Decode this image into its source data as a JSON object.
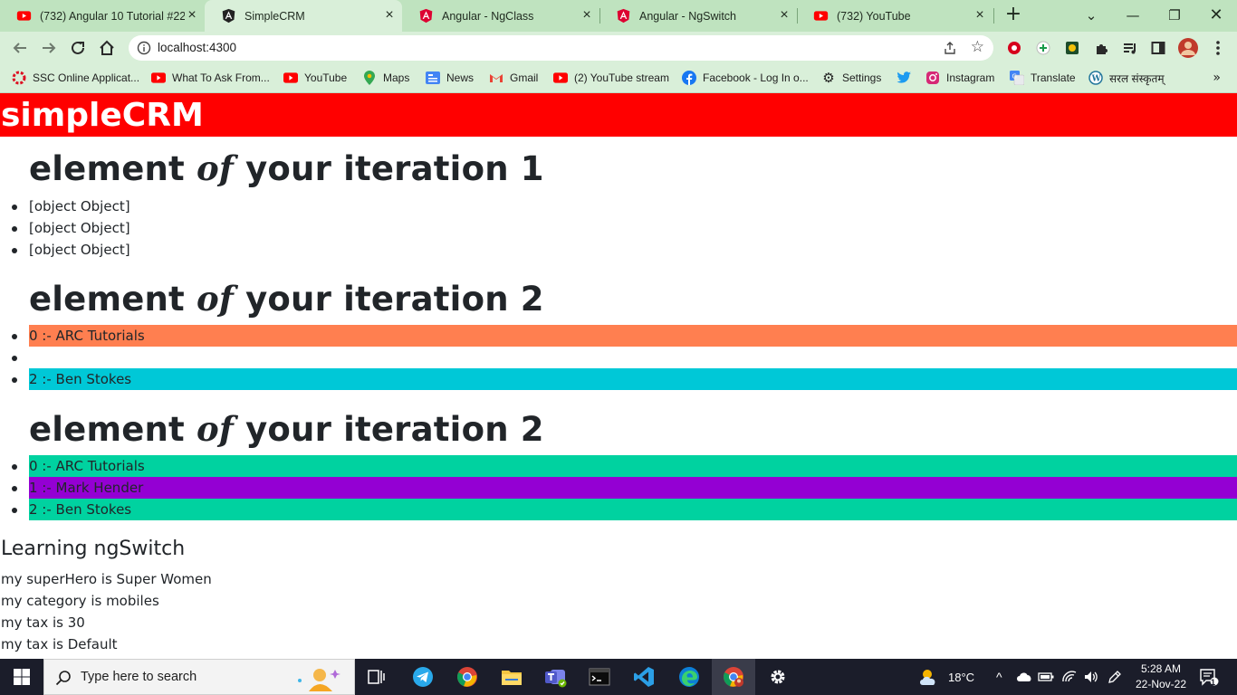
{
  "browser": {
    "tabs": [
      {
        "label": "(732) Angular 10 Tutorial #22",
        "icon": "youtube-icon",
        "active": false
      },
      {
        "label": "SimpleCRM",
        "icon": "angular-icon",
        "active": true
      },
      {
        "label": "Angular - NgClass",
        "icon": "angular-icon",
        "active": false
      },
      {
        "label": "Angular - NgSwitch",
        "icon": "angular-icon",
        "active": false
      },
      {
        "label": "(732) YouTube",
        "icon": "youtube-icon",
        "active": false
      }
    ],
    "url": "localhost:4300",
    "bookmarks": [
      {
        "label": "SSC Online Applicat...",
        "icon": "ssc-icon"
      },
      {
        "label": "What To Ask From...",
        "icon": "youtube-icon"
      },
      {
        "label": "YouTube",
        "icon": "youtube-icon"
      },
      {
        "label": "Maps",
        "icon": "maps-icon"
      },
      {
        "label": "News",
        "icon": "news-icon"
      },
      {
        "label": "Gmail",
        "icon": "gmail-icon"
      },
      {
        "label": "(2) YouTube stream",
        "icon": "youtube-icon"
      },
      {
        "label": "Facebook - Log In o...",
        "icon": "facebook-icon"
      },
      {
        "label": "Settings",
        "icon": "gear-icon"
      },
      {
        "label": "",
        "icon": "twitter-icon"
      },
      {
        "label": "Instagram",
        "icon": "instagram-icon"
      },
      {
        "label": "Translate",
        "icon": "translate-icon"
      },
      {
        "label": "सरल संस्कृतम्",
        "icon": "wordpress-icon"
      }
    ],
    "bookmarks_more": "»"
  },
  "app": {
    "title": "simpleCRM",
    "section1": {
      "heading_a": "element ",
      "heading_b": "of",
      "heading_c": " your iteration 1",
      "items": [
        "[object Object]",
        "[object Object]",
        "[object Object]"
      ]
    },
    "section2": {
      "heading_a": "element ",
      "heading_b": "of",
      "heading_c": " your iteration 2",
      "items": [
        {
          "text": "0 :- ARC Tutorials",
          "color": "#ff7f50"
        },
        {
          "text": "",
          "color": "#ffffff"
        },
        {
          "text": "2 :- Ben Stokes",
          "color": "#00c8d7"
        }
      ]
    },
    "section3": {
      "heading_a": "element ",
      "heading_b": "of",
      "heading_c": " your iteration 2",
      "items": [
        {
          "text": "0 :- ARC Tutorials",
          "color": "#00d2a0"
        },
        {
          "text": "1 :- Mark Hender",
          "color": "#9400d3"
        },
        {
          "text": "2 :- Ben Stokes",
          "color": "#00d2a0"
        }
      ]
    },
    "switch_heading": "Learning ngSwitch",
    "switch_lines": [
      "my superHero is Super Women",
      "my category is mobiles",
      "my tax is 30",
      "my tax is Default"
    ]
  },
  "taskbar": {
    "search_placeholder": "Type here to search",
    "temperature": "18°C",
    "time": "5:28 AM",
    "date": "22-Nov-22",
    "notification_count": "1"
  },
  "colors": {
    "header_red": "#ff0000",
    "chrome_green": "#bfe3bf",
    "chrome_green_light": "#d9efd9",
    "taskbar": "#1b1d2a"
  }
}
